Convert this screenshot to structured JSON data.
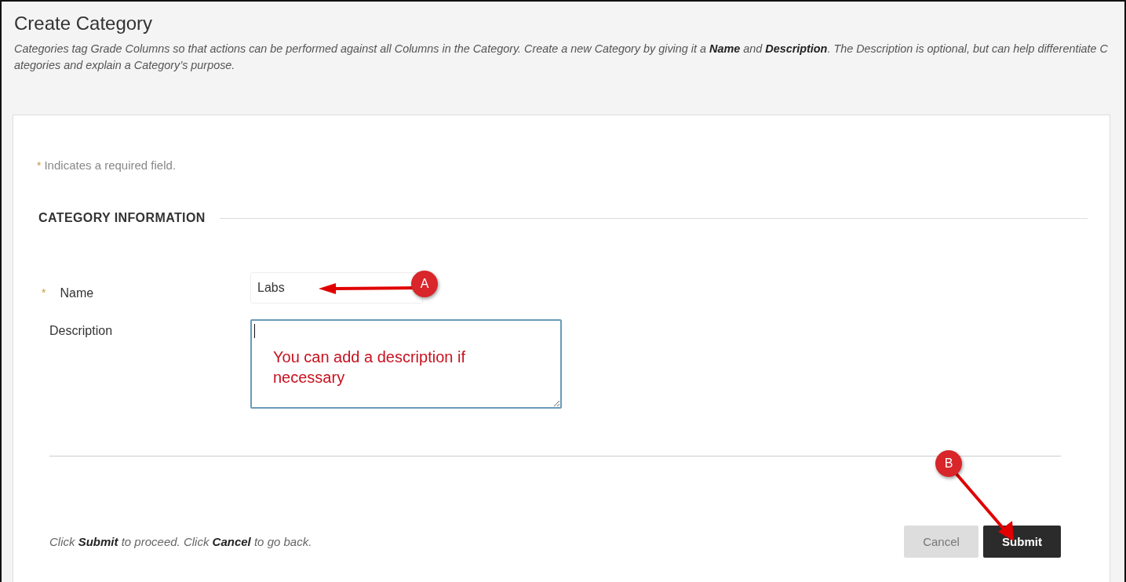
{
  "page": {
    "title": "Create Category",
    "intro": "Categories tag Grade Columns so that actions can be performed against all Columns in the Category. Create a new Category by giving it a **Name** and **Description**. The Description is optional, but can help differentiate Categories and explain a Category’s purpose."
  },
  "required_note": {
    "mark": "*",
    "text": "Indicates a required field."
  },
  "section": {
    "heading": "CATEGORY INFORMATION"
  },
  "fields": [
    {
      "kind": "input",
      "label": "Name",
      "required": true,
      "value": "Labs"
    },
    {
      "kind": "textarea",
      "label": "Description",
      "required": false,
      "focused": true
    }
  ],
  "footer": {
    "instruction": "Click **Submit** to proceed. Click **Cancel** to go back.",
    "buttons": [
      {
        "label": "Cancel",
        "primary": false
      },
      {
        "label": "Submit",
        "primary": true
      }
    ]
  },
  "annotations": [
    {
      "kind": "marker",
      "label": "A"
    },
    {
      "kind": "marker",
      "label": "B"
    },
    {
      "kind": "note",
      "text": "You can add a description if necessary"
    }
  ]
}
